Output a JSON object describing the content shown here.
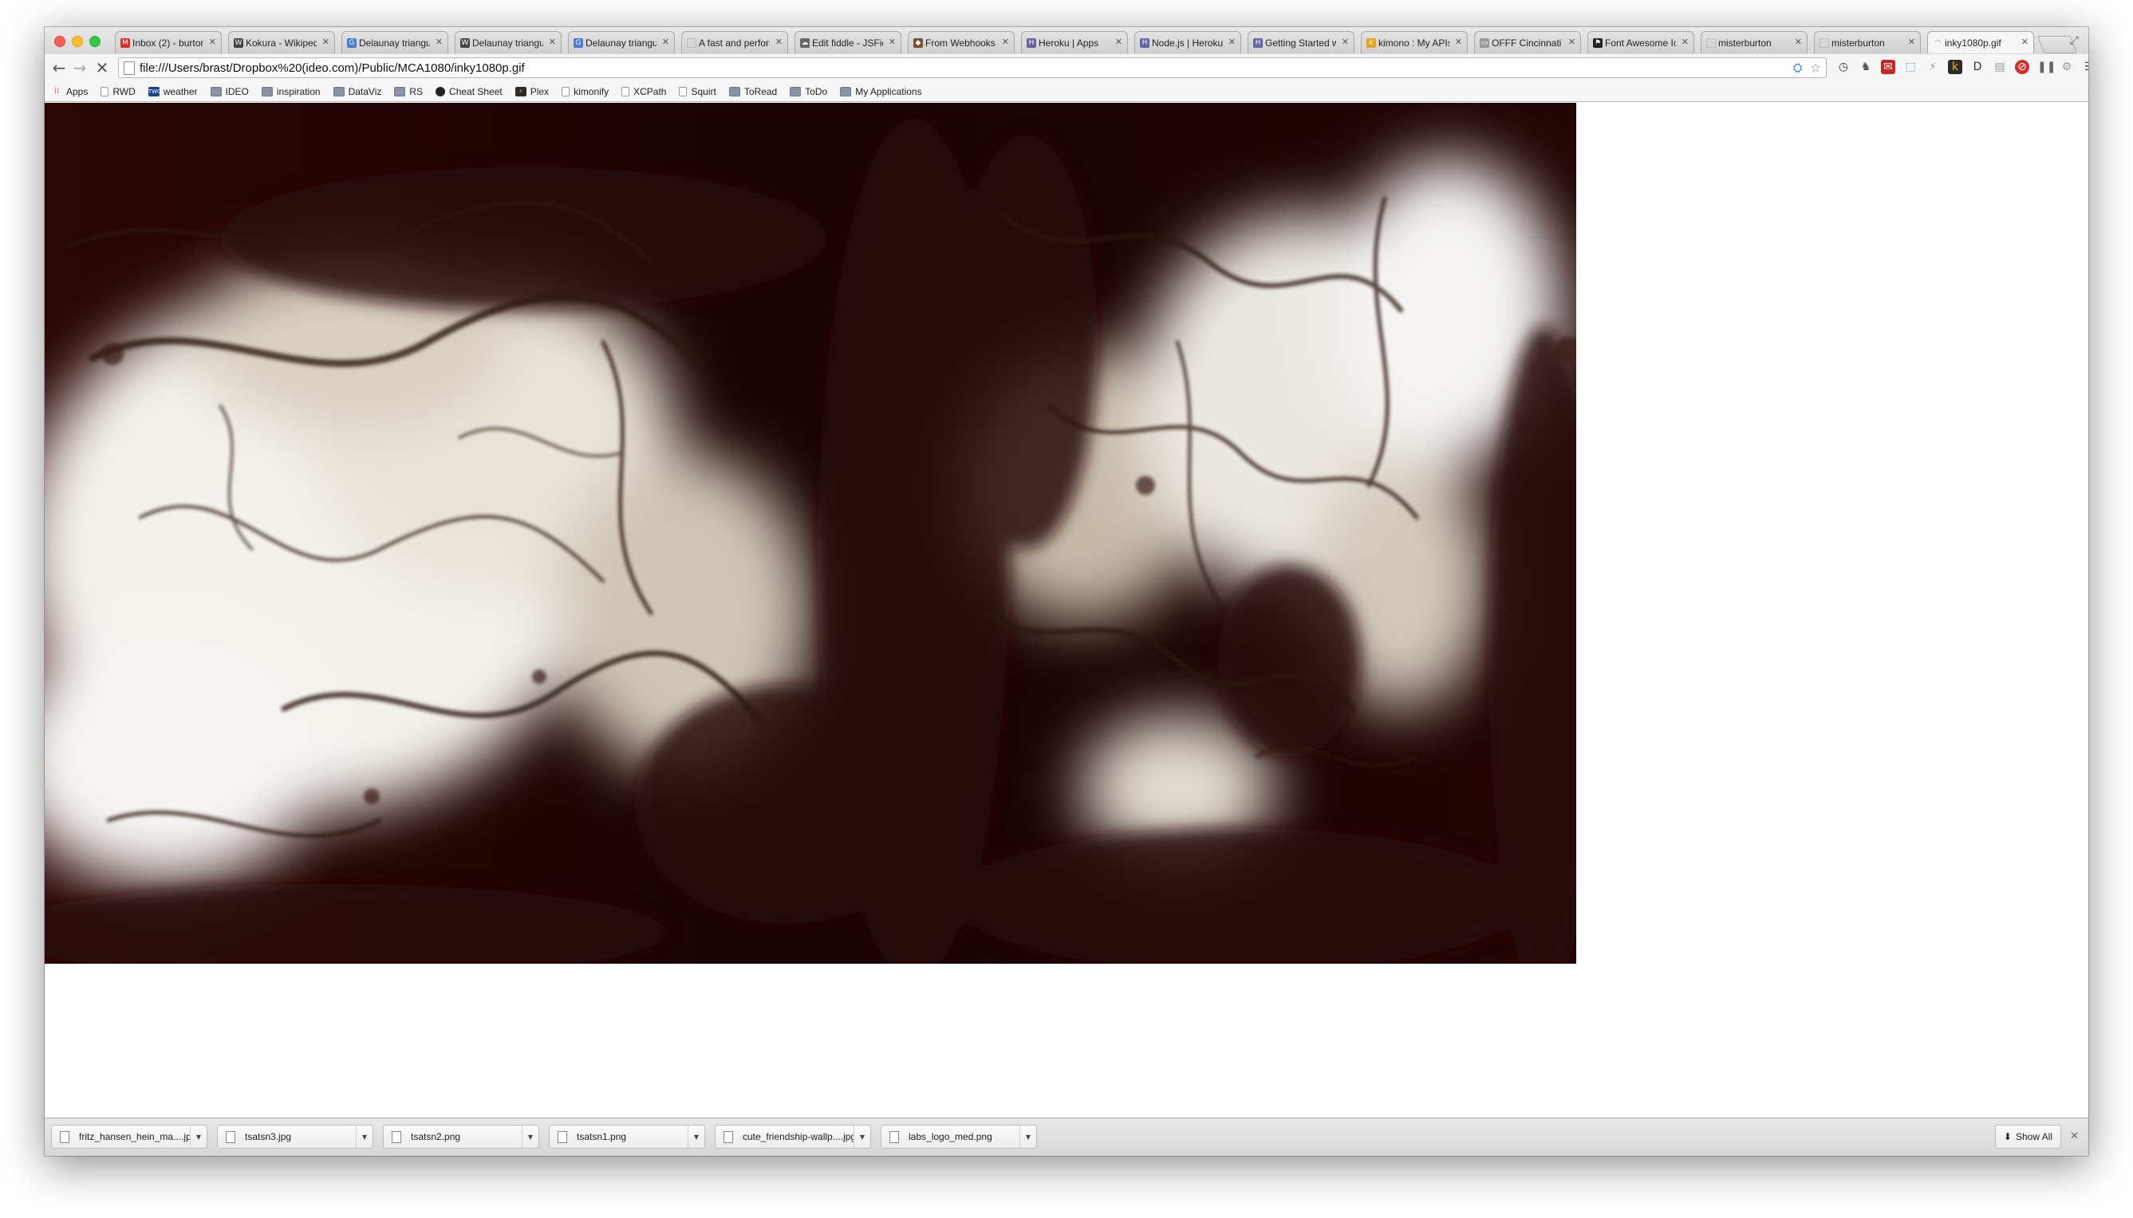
{
  "browser": {
    "tabs": [
      {
        "title": "Inbox (2) - burton",
        "favicon": "gmail-icon",
        "favicon_text": "M",
        "favicon_color": "#d93025",
        "active": false
      },
      {
        "title": "Kokura - Wikipedia",
        "favicon": "wikipedia-icon",
        "favicon_text": "W",
        "favicon_color": "#444444",
        "active": false
      },
      {
        "title": "Delaunay triangulation",
        "favicon": "google-docs-icon",
        "favicon_text": "G",
        "favicon_color": "#4a7bd0",
        "active": false
      },
      {
        "title": "Delaunay triangulation",
        "favicon": "wikipedia-icon",
        "favicon_text": "W",
        "favicon_color": "#444444",
        "active": false
      },
      {
        "title": "Delaunay triangulation",
        "favicon": "google-docs-icon",
        "favicon_text": "G",
        "favicon_color": "#4a7bd0",
        "active": false
      },
      {
        "title": "A fast and performant",
        "favicon": "page-icon",
        "favicon_text": "",
        "favicon_color": "#bbbbbb",
        "active": false
      },
      {
        "title": "Edit fiddle - JSFiddle",
        "favicon": "cloud-icon",
        "favicon_text": "☁",
        "favicon_color": "#666666",
        "active": false
      },
      {
        "title": "From Webhooks",
        "favicon": "webhooks-icon",
        "favicon_text": "◆",
        "favicon_color": "#7a5230",
        "active": false
      },
      {
        "title": "Heroku | Apps",
        "favicon": "heroku-icon",
        "favicon_text": "H",
        "favicon_color": "#6762a6",
        "active": false
      },
      {
        "title": "Node.js | Heroku",
        "favicon": "heroku-icon",
        "favicon_text": "H",
        "favicon_color": "#6762a6",
        "active": false
      },
      {
        "title": "Getting Started with",
        "favicon": "heroku-icon",
        "favicon_text": "H",
        "favicon_color": "#6762a6",
        "active": false
      },
      {
        "title": "kimono : My APIs",
        "favicon": "kimono-icon",
        "favicon_text": "k",
        "favicon_color": "#e8a11a",
        "active": false
      },
      {
        "title": "OFFF Cincinnati",
        "favicon": "offf-icon",
        "favicon_text": "▭",
        "favicon_color": "#999999",
        "active": false
      },
      {
        "title": "Font Awesome Icons",
        "favicon": "flag-icon",
        "favicon_text": "⚑",
        "favicon_color": "#222222",
        "active": false
      },
      {
        "title": "misterburton",
        "favicon": "page-icon",
        "favicon_text": "",
        "favicon_color": "#bbbbbb",
        "active": false
      },
      {
        "title": "misterburton",
        "favicon": "page-icon",
        "favicon_text": "",
        "favicon_color": "#bbbbbb",
        "active": false
      },
      {
        "title": "inky1080p.gif",
        "favicon": "loading-icon",
        "favicon_text": "◠",
        "favicon_color": "#888888",
        "active": true
      }
    ],
    "toolbar": {
      "url": "file:///Users/brast/Dropbox%20(ideo.com)/Public/MCA1080/inky1080p.gif"
    },
    "bookmarks": [
      {
        "label": "Apps",
        "icon": "apps-grid-icon",
        "kind": "apps"
      },
      {
        "label": "RWD",
        "icon": "page-icon",
        "kind": "page"
      },
      {
        "label": "weather",
        "icon": "weather-channel-icon",
        "kind": "twc"
      },
      {
        "label": "IDEO",
        "icon": "folder-icon",
        "kind": "folder"
      },
      {
        "label": "inspiration",
        "icon": "folder-icon",
        "kind": "folder"
      },
      {
        "label": "DataViz",
        "icon": "folder-icon",
        "kind": "folder"
      },
      {
        "label": "RS",
        "icon": "folder-icon",
        "kind": "folder"
      },
      {
        "label": "Cheat Sheet",
        "icon": "github-icon",
        "kind": "github"
      },
      {
        "label": "Plex",
        "icon": "plex-icon",
        "kind": "plex"
      },
      {
        "label": "kimonify",
        "icon": "page-icon",
        "kind": "page"
      },
      {
        "label": "XCPath",
        "icon": "page-icon",
        "kind": "page"
      },
      {
        "label": "Squirt",
        "icon": "page-icon",
        "kind": "page"
      },
      {
        "label": "ToRead",
        "icon": "folder-icon",
        "kind": "folder"
      },
      {
        "label": "ToDo",
        "icon": "folder-icon",
        "kind": "folder"
      },
      {
        "label": "My Applications",
        "icon": "folder-icon",
        "kind": "folder"
      }
    ],
    "downloads": [
      {
        "filename": "fritz_hansen_hein_ma....jpg"
      },
      {
        "filename": "tsatsn3.jpg"
      },
      {
        "filename": "tsatsn2.png"
      },
      {
        "filename": "tsatsn1.png"
      },
      {
        "filename": "cute_friendship-wallp....jpg"
      },
      {
        "filename": "labs_logo_med.png"
      }
    ],
    "show_all_label": "Show All"
  },
  "colors": {
    "ink_dark": "#1e0404",
    "ink_light": "#f2f0ec"
  }
}
